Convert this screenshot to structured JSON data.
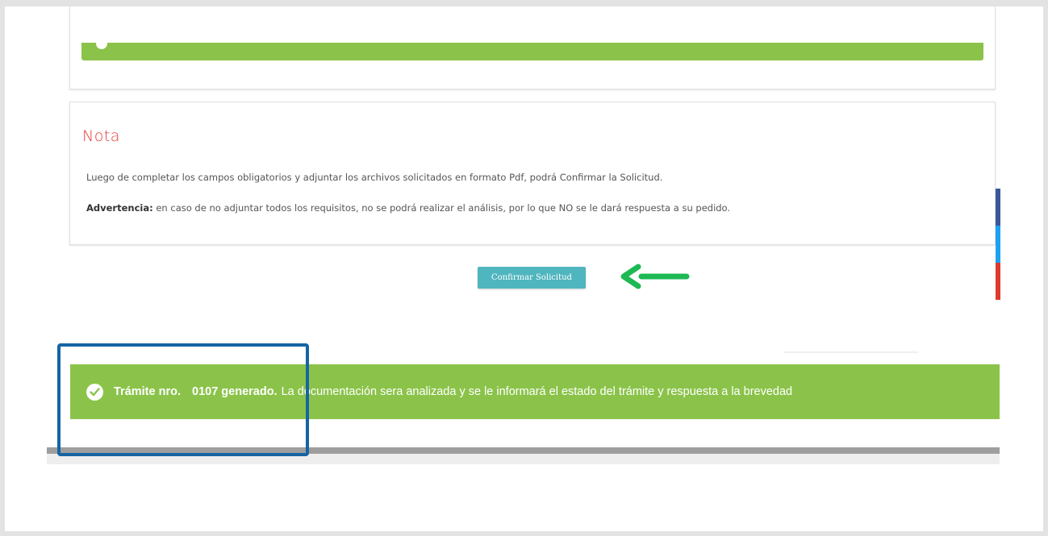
{
  "note": {
    "title": "Nota",
    "line1": "Luego de completar los campos obligatorios y adjuntar los archivos solicitados en formato Pdf, podrá Confirmar la Solicitud.",
    "warning_label": "Advertencia:",
    "warning_text": " en caso de no adjuntar todos los requisitos, no se podrá realizar el análisis, por lo que NO se le dará respuesta a su pedido."
  },
  "confirm_button": {
    "label": "Confirmar Solicitud"
  },
  "success": {
    "prefix": "Trámite nro.",
    "number_text": "0107 generado.",
    "message": "La documentación sera analizada y se le informará el estado del trámite y respuesta a la brevedad",
    "icon": "check-circle-icon"
  },
  "colors": {
    "success_green": "#8bc34a",
    "note_title_red": "#e53935",
    "button_teal": "#4fb5bf",
    "highlight_blue": "#1565a3",
    "arrow_green": "#1db954",
    "facebook_blue": "#3b5998",
    "twitter_blue": "#1da1f2",
    "google_red": "#dd3a2c"
  }
}
